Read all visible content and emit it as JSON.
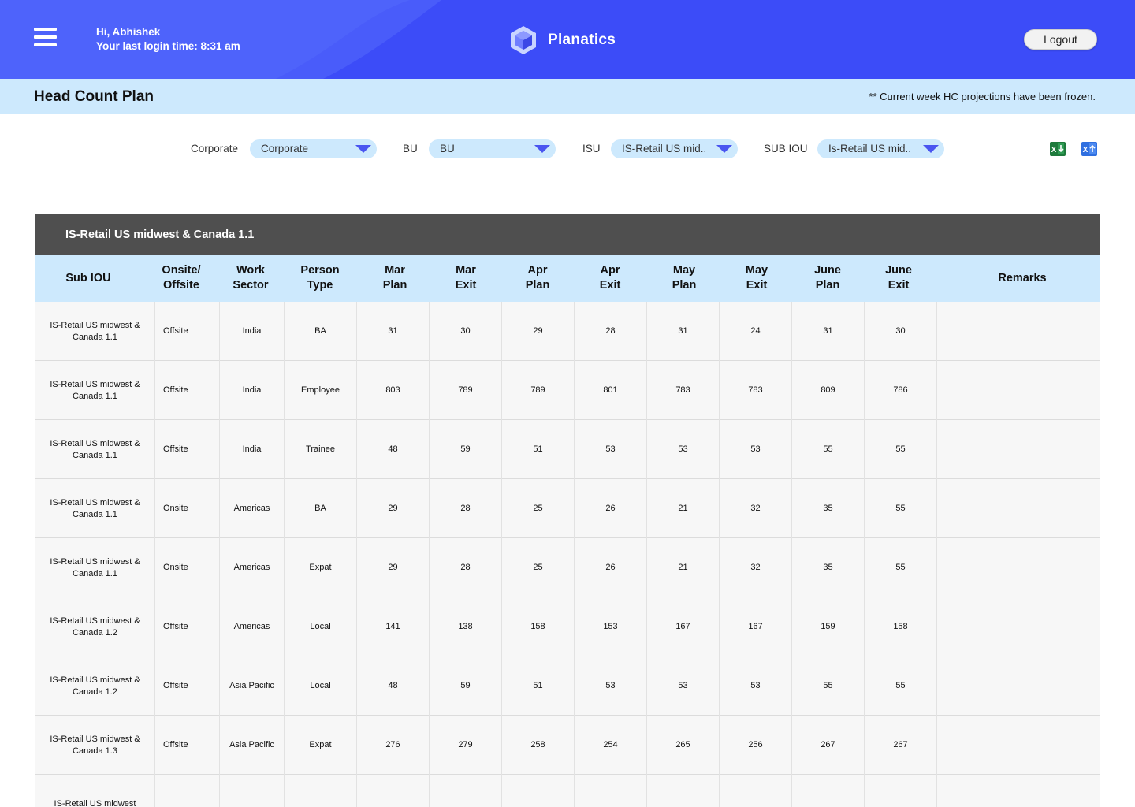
{
  "header": {
    "greeting_line1": "Hi, Abhishek",
    "greeting_line2": "Your last login time: 8:31 am",
    "app_name": "Planatics",
    "logout_label": "Logout",
    "menu_icon": "hamburger-menu-icon",
    "logo_icon": "hexagon-cube-logo",
    "colors": {
      "primary": "#3d4df8",
      "wave": "#4a5bff",
      "light": "#cde9fd"
    }
  },
  "subheader": {
    "title": "Head Count Plan",
    "note": "** Current week HC projections have been frozen."
  },
  "filters": {
    "corporate": {
      "label": "Corporate",
      "value": "Corporate"
    },
    "bu": {
      "label": "BU",
      "value": "BU"
    },
    "isu": {
      "label": "ISU",
      "value": "IS-Retail US mid.."
    },
    "sub_iou": {
      "label": "SUB IOU",
      "value": "Is-Retail US mid.."
    },
    "export_excel_icon": "excel-download-icon",
    "import_excel_icon": "excel-upload-icon"
  },
  "table": {
    "group_title": "IS-Retail US midwest & Canada 1.1",
    "columns": [
      "Sub IOU",
      "Onsite/ Offsite",
      "Work Sector",
      "Person Type",
      "Mar Plan",
      "Mar Exit",
      "Apr Plan",
      "Apr Exit",
      "May Plan",
      "May Exit",
      "June Plan",
      "June Exit",
      "Remarks"
    ],
    "rows": [
      [
        "IS-Retail US midwest & Canada 1.1",
        "Offsite",
        "India",
        "BA",
        "31",
        "30",
        "29",
        "28",
        "31",
        "24",
        "31",
        "30",
        ""
      ],
      [
        "IS-Retail US midwest & Canada 1.1",
        "Offsite",
        "India",
        "Employee",
        "803",
        "789",
        "789",
        "801",
        "783",
        "783",
        "809",
        "786",
        ""
      ],
      [
        "IS-Retail US midwest & Canada 1.1",
        "Offsite",
        "India",
        "Trainee",
        "48",
        "59",
        "51",
        "53",
        "53",
        "53",
        "55",
        "55",
        ""
      ],
      [
        "IS-Retail US midwest & Canada 1.1",
        "Onsite",
        "Americas",
        "BA",
        "29",
        "28",
        "25",
        "26",
        "21",
        "32",
        "35",
        "55",
        ""
      ],
      [
        "IS-Retail US midwest & Canada 1.1",
        "Onsite",
        "Americas",
        "Expat",
        "29",
        "28",
        "25",
        "26",
        "21",
        "32",
        "35",
        "55",
        ""
      ],
      [
        "IS-Retail US midwest & Canada 1.2",
        "Offsite",
        "Americas",
        "Local",
        "141",
        "138",
        "158",
        "153",
        "167",
        "167",
        "159",
        "158",
        ""
      ],
      [
        "IS-Retail US midwest & Canada 1.2",
        "Offsite",
        "Asia Pacific",
        "Local",
        "48",
        "59",
        "51",
        "53",
        "53",
        "53",
        "55",
        "55",
        ""
      ],
      [
        "IS-Retail US midwest & Canada 1.3",
        "Offsite",
        "Asia Pacific",
        "Expat",
        "276",
        "279",
        "258",
        "254",
        "265",
        "256",
        "267",
        "267",
        ""
      ],
      [
        "IS-Retail US midwest",
        "",
        "",
        "",
        "",
        "",
        "",
        "",
        "",
        "",
        "",
        "",
        ""
      ]
    ]
  }
}
